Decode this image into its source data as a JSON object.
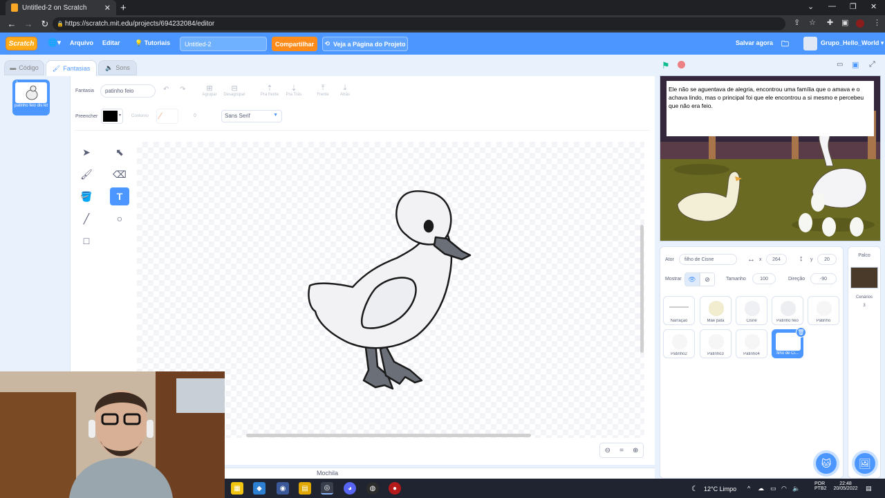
{
  "browser": {
    "tab_title": "Untitled-2 on Scratch",
    "url": "https://scratch.mit.edu/projects/694232084/editor"
  },
  "menubar": {
    "logo": "Scratch",
    "file": "Arquivo",
    "edit": "Editar",
    "tutorials": "Tutoriais",
    "project_title": "Untitled-2",
    "share": "Compartilhar",
    "see_project": "Veja a Página do Projeto",
    "save_now": "Salvar agora",
    "username": "Grupo_Hello_World"
  },
  "editor_tabs": {
    "code": "Código",
    "costumes": "Fantasias",
    "sounds": "Sons"
  },
  "costume_list": [
    {
      "number": "1",
      "name": "patinho feio dis kit"
    }
  ],
  "paint": {
    "costume_label": "Fantasia",
    "costume_name": "patinho feio",
    "group": "Agrupar",
    "ungroup": "Desagrupar",
    "forward": "Pra frente",
    "backward": "Pra Trás",
    "front": "Frente",
    "back": "Atrás",
    "fill_label": "Preencher",
    "outline_label": "Contorno",
    "outline_size": "0",
    "font": "Sans Serif",
    "zoom_reset": "="
  },
  "backpack": "Mochila",
  "stage": {
    "speech": "Ele não se aguentava de alegria, encontrou uma família que o amava e o achava lindo, mas o principal foi que ele encontrou a si mesmo  e percebeu que não era feio."
  },
  "sprite_info": {
    "actor_label": "Ator",
    "actor_name": "filho de Cisne",
    "x_label": "x",
    "x": "264",
    "y_label": "y",
    "y": "20",
    "show_label": "Mostrar",
    "size_label": "Tamanho",
    "size": "100",
    "direction_label": "Direção",
    "direction": "-90"
  },
  "sprites": [
    {
      "name": "Narração"
    },
    {
      "name": "Mãe pata"
    },
    {
      "name": "Cisne"
    },
    {
      "name": "Patinho feio"
    },
    {
      "name": "Patinho"
    },
    {
      "name": "Patinho2"
    },
    {
      "name": "Patinho3"
    },
    {
      "name": "Patinho4"
    },
    {
      "name": "filho de Ci..."
    }
  ],
  "stage_pane": {
    "label": "Palco",
    "backdrops_label": "Cenários",
    "backdrops_count": "3"
  },
  "taskbar": {
    "weather": "12°C  Limpo",
    "lang1": "POR",
    "lang2": "PTB2",
    "time": "22:48",
    "date": "20/05/2022"
  },
  "colors": {
    "scratch_blue": "#4c97ff",
    "share_orange": "#ff8c1a",
    "logo_orange": "#ffab19"
  }
}
